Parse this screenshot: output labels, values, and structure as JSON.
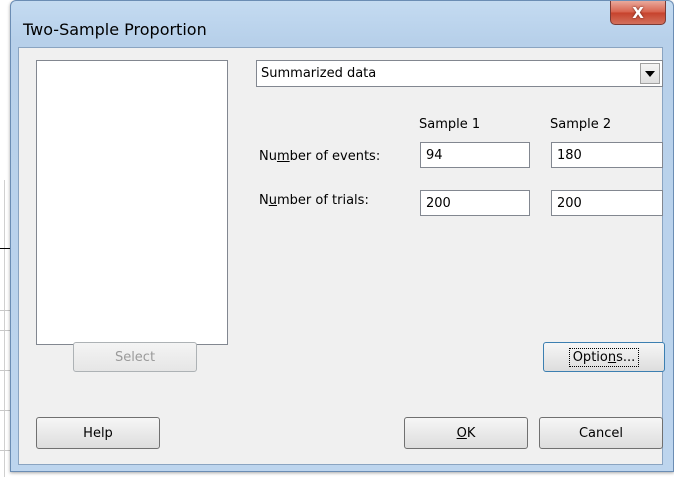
{
  "window": {
    "title": "Two-Sample Proportion",
    "close_glyph": "X"
  },
  "data_source": {
    "selected": "Summarized data"
  },
  "columns": {
    "sample1": "Sample 1",
    "sample2": "Sample 2"
  },
  "rows": {
    "events": {
      "label_pre": "Nu",
      "label_mnemonic": "m",
      "label_post": "ber of events:",
      "sample1": "94",
      "sample2": "180"
    },
    "trials": {
      "label_pre": "N",
      "label_mnemonic": "u",
      "label_post": "mber of trials:",
      "sample1": "200",
      "sample2": "200"
    }
  },
  "buttons": {
    "select": "Select",
    "options_pre": "Optio",
    "options_mnemonic": "n",
    "options_post": "s...",
    "help": "Help",
    "ok_mnemonic": "O",
    "ok_post": "K",
    "cancel": "Cancel"
  },
  "colors": {
    "close_button": "#c6422c",
    "title_bar": "#c4dbf1"
  }
}
